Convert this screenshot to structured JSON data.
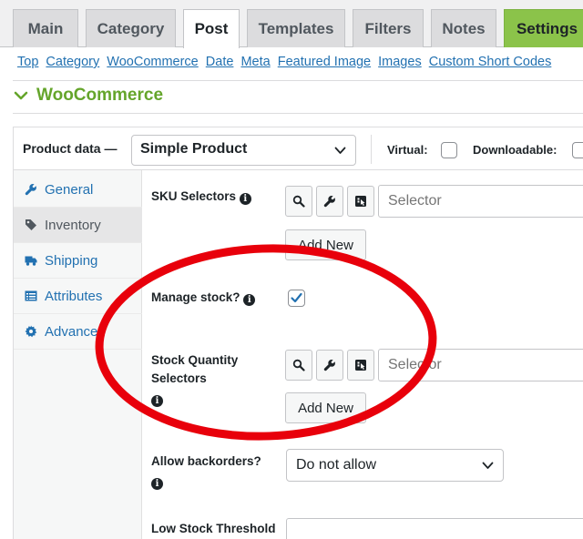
{
  "tabs": [
    {
      "label": "Main"
    },
    {
      "label": "Category"
    },
    {
      "label": "Post"
    },
    {
      "label": "Templates"
    },
    {
      "label": "Filters"
    },
    {
      "label": "Notes"
    },
    {
      "label": "Settings"
    }
  ],
  "subnav": [
    "Top",
    "Category",
    "WooCommerce",
    "Date",
    "Meta",
    "Featured Image",
    "Images",
    "Custom Short Codes"
  ],
  "section": {
    "title": "WooCommerce"
  },
  "product_data": {
    "label": "Product data —",
    "type_selected": "Simple Product",
    "virtual_label": "Virtual:",
    "downloadable_label": "Downloadable:"
  },
  "vtabs": [
    {
      "label": "General",
      "icon": "wrench-icon"
    },
    {
      "label": "Inventory",
      "icon": "tag-icon"
    },
    {
      "label": "Shipping",
      "icon": "truck-icon"
    },
    {
      "label": "Attributes",
      "icon": "list-icon"
    },
    {
      "label": "Advanced",
      "icon": "gear-icon"
    }
  ],
  "fields": {
    "sku": {
      "label": "SKU Selectors",
      "placeholder": "Selector",
      "add_new": "Add New"
    },
    "manage_stock": {
      "label": "Manage stock?",
      "checked": true
    },
    "stock_quantity": {
      "label_line1": "Stock Quantity",
      "label_line2": "Selectors",
      "placeholder": "Selector",
      "add_new": "Add New"
    },
    "backorders": {
      "label": "Allow backorders?",
      "selected": "Do not allow"
    },
    "low_stock": {
      "label": "Low Stock Threshold"
    }
  },
  "colors": {
    "accent_green": "#65a52b",
    "settings_tab": "#8bc34a",
    "link_blue": "#2271b1",
    "annotation_red": "#e8000b"
  }
}
